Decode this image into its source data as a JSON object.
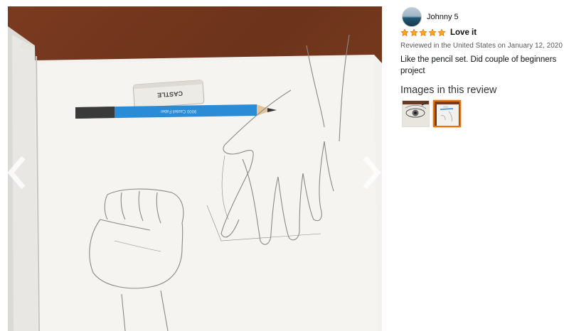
{
  "review": {
    "reviewer_name": "Johnny 5",
    "rating": 5,
    "title": "Love it",
    "meta": "Reviewed in the United States on January 12, 2020",
    "body": "Like the pencil set. Did couple of beginners project"
  },
  "images_section": {
    "heading": "Images in this review",
    "thumbnails": [
      {
        "name": "eye-sketch",
        "selected": false
      },
      {
        "name": "hand-sketch",
        "selected": true
      }
    ]
  },
  "photo": {
    "eraser_label": "CASTLE",
    "pencil_label": "9000 Castell Faber"
  },
  "colors": {
    "star": "#ffa41c",
    "selected_border": "#e77600",
    "pencil": "#2a8bd6"
  }
}
